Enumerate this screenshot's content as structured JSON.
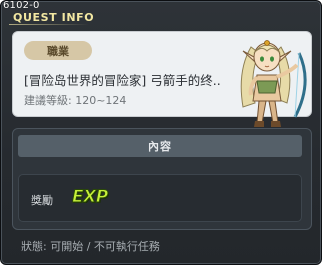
{
  "window": {
    "quest_id": "6102-0",
    "title": "QUEST INFO"
  },
  "quest": {
    "job_badge": "職業",
    "name": "[冒险岛世界的冒险家] 弓箭手的终..",
    "level_range": "建議等級: 120~124"
  },
  "content": {
    "header": "內容",
    "reward_label": "獎勵",
    "reward_icon_text": "EXP"
  },
  "status": "狀態: 可開始 / 不可執行任務",
  "icons": {
    "npc": "elf-archer-npc-icon",
    "exp": "exp-icon"
  },
  "colors": {
    "title": "#f2e7a2",
    "exp": "#c8f23a"
  }
}
